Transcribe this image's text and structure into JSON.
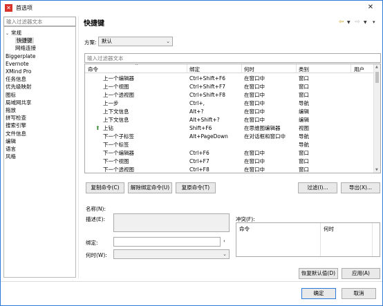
{
  "window": {
    "title": "首选项"
  },
  "sidebar": {
    "filter_placeholder": "输入过滤器文本",
    "items": [
      {
        "label": "常规",
        "level": 0,
        "expanded": true
      },
      {
        "label": "快捷键",
        "level": 1,
        "selected": true
      },
      {
        "label": "网络连接",
        "level": 1
      },
      {
        "label": "Biggerplate",
        "level": 0
      },
      {
        "label": "Evernote",
        "level": 0
      },
      {
        "label": "XMind Pro",
        "level": 0
      },
      {
        "label": "任务信息",
        "level": 0
      },
      {
        "label": "优先级映射",
        "level": 0
      },
      {
        "label": "图标",
        "level": 0
      },
      {
        "label": "局域网共享",
        "level": 0
      },
      {
        "label": "拖放",
        "level": 0
      },
      {
        "label": "拼写检查",
        "level": 0
      },
      {
        "label": "搜索引擎",
        "level": 0
      },
      {
        "label": "文件信息",
        "level": 0
      },
      {
        "label": "编辑",
        "level": 0
      },
      {
        "label": "语言",
        "level": 0
      },
      {
        "label": "风格",
        "level": 0
      }
    ]
  },
  "main": {
    "title": "快捷键",
    "scheme_label": "方案:",
    "scheme_value": "默认",
    "filter_placeholder": "输入过滤器文本",
    "table": {
      "headers": [
        "命令",
        "绑定",
        "何时",
        "类别",
        "用户"
      ],
      "rows": [
        {
          "command": "上一个编辑器",
          "binding": "Ctrl+Shift+F6",
          "when": "在窗口中",
          "category": "窗口",
          "user": ""
        },
        {
          "command": "上一个视图",
          "binding": "Ctrl+Shift+F7",
          "when": "在窗口中",
          "category": "窗口",
          "user": ""
        },
        {
          "command": "上一个透视图",
          "binding": "Ctrl+Shift+F8",
          "when": "在窗口中",
          "category": "窗口",
          "user": ""
        },
        {
          "command": "上一步",
          "binding": "Ctrl+,",
          "when": "在窗口中",
          "category": "导航",
          "user": ""
        },
        {
          "command": "上下文信息",
          "binding": "Alt+?",
          "when": "在窗口中",
          "category": "编辑",
          "user": ""
        },
        {
          "command": "上下文信息",
          "binding": "Alt+Shift+?",
          "when": "在窗口中",
          "category": "编辑",
          "user": ""
        },
        {
          "command": "上钻",
          "binding": "Shift+F6",
          "when": "在思维图编辑器",
          "category": "视图",
          "user": "",
          "icon": true
        },
        {
          "command": "下一个子标签",
          "binding": "Alt+PageDown",
          "when": "在对话框和窗口中",
          "category": "导航",
          "user": ""
        },
        {
          "command": "下一个标签",
          "binding": "",
          "when": "",
          "category": "导航",
          "user": ""
        },
        {
          "command": "下一个编辑器",
          "binding": "Ctrl+F6",
          "when": "在窗口中",
          "category": "窗口",
          "user": ""
        },
        {
          "command": "下一个视图",
          "binding": "Ctrl+F7",
          "when": "在窗口中",
          "category": "窗口",
          "user": ""
        },
        {
          "command": "下一个透视图",
          "binding": "Ctrl+F8",
          "when": "在窗口中",
          "category": "窗口",
          "user": ""
        }
      ]
    },
    "buttons": {
      "copy": "复制命令(C)",
      "unbind": "解除绑定命令(U)",
      "restore": "复原命令(T)",
      "filter": "过滤(I)...",
      "export": "导出(X)..."
    },
    "details": {
      "name_label": "名称(N):",
      "desc_label": "描述(E):",
      "binding_label": "绑定:",
      "binding_value": "",
      "when_label": "何时(W):",
      "conflict_label": "冲突(F):",
      "conflict_headers": [
        "命令",
        "何时"
      ]
    },
    "restore_defaults": "恢复默认值(D)",
    "apply": "应用(A)"
  },
  "footer": {
    "ok": "确定",
    "cancel": "取消"
  }
}
